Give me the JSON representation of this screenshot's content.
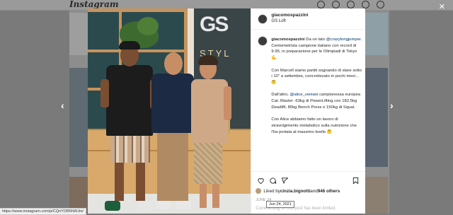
{
  "background": {
    "logo": "Instagram",
    "header_icons": [
      "home-icon",
      "messenger-icon",
      "explore-icon",
      "heart-icon",
      "avatar-icon"
    ]
  },
  "modal": {
    "close_label": "×",
    "prev_label": "‹",
    "next_label": "›"
  },
  "post": {
    "username": "giacomospazzini",
    "location": "GS Loft",
    "photo_logo_text": "GS",
    "photo_logo_word": "STYL",
    "caption": {
      "author": "giacomospazzini",
      "p1_intro": " Da un lato ",
      "p1_mention": "@crazylongjumper",
      "p1_rest": ". Centometrista campione italiano con record di 9.95, in preparazione per le Olimpiadi di Tokyo 💪",
      "p2": "Con Marcell siamo partiti sognando di stare sotto i 10'' a settembre, concretizzato in pochi mesi… 🤔",
      "p3_intro": "Dall'altro, ",
      "p3_mention": "@alice_veniani",
      "p3_rest": " campionessa europea Cat. Master -63kg di PowerLifting con 182.5kg Deadlift, 80kg Bench Press e 150kg di Squat.",
      "p4": "Con Alice abbiamo fatto un lavoro di stravolgimento metabolico sulla nutrizione che l'ha portata al massimo livello 🤔"
    },
    "liked_prefix": "Liked by ",
    "liked_user": "cinzia.bignotti",
    "liked_and": " and ",
    "liked_others": "946 others",
    "date": "JUNE 24",
    "limited_text": "Commenting on this post has been limited.",
    "tooltip": "Jun 24, 2021"
  },
  "status_bar_url": "https://www.instagram.com/p/CQnYOB5hWJm/",
  "colors": {
    "link": "#00376b",
    "text": "#262626",
    "muted": "#8e8e8e"
  }
}
